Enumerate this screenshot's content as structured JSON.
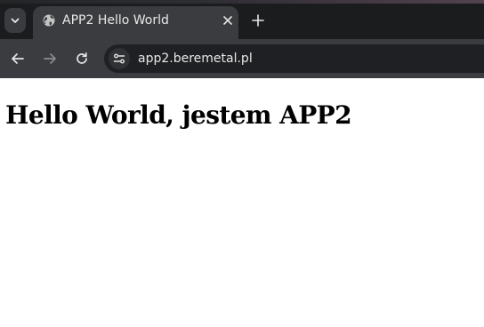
{
  "tab": {
    "title": "APP2 Hello World"
  },
  "address_bar": {
    "url": "app2.beremetal.pl"
  },
  "page": {
    "heading": "Hello World, jestem APP2"
  },
  "icons": {
    "tab_search": "chevron-down-icon",
    "favicon": "globe-icon",
    "close_tab": "close-icon",
    "new_tab": "plus-icon",
    "back": "arrow-left-icon",
    "forward": "arrow-right-icon",
    "reload": "reload-icon",
    "site_info": "tune-icon"
  }
}
